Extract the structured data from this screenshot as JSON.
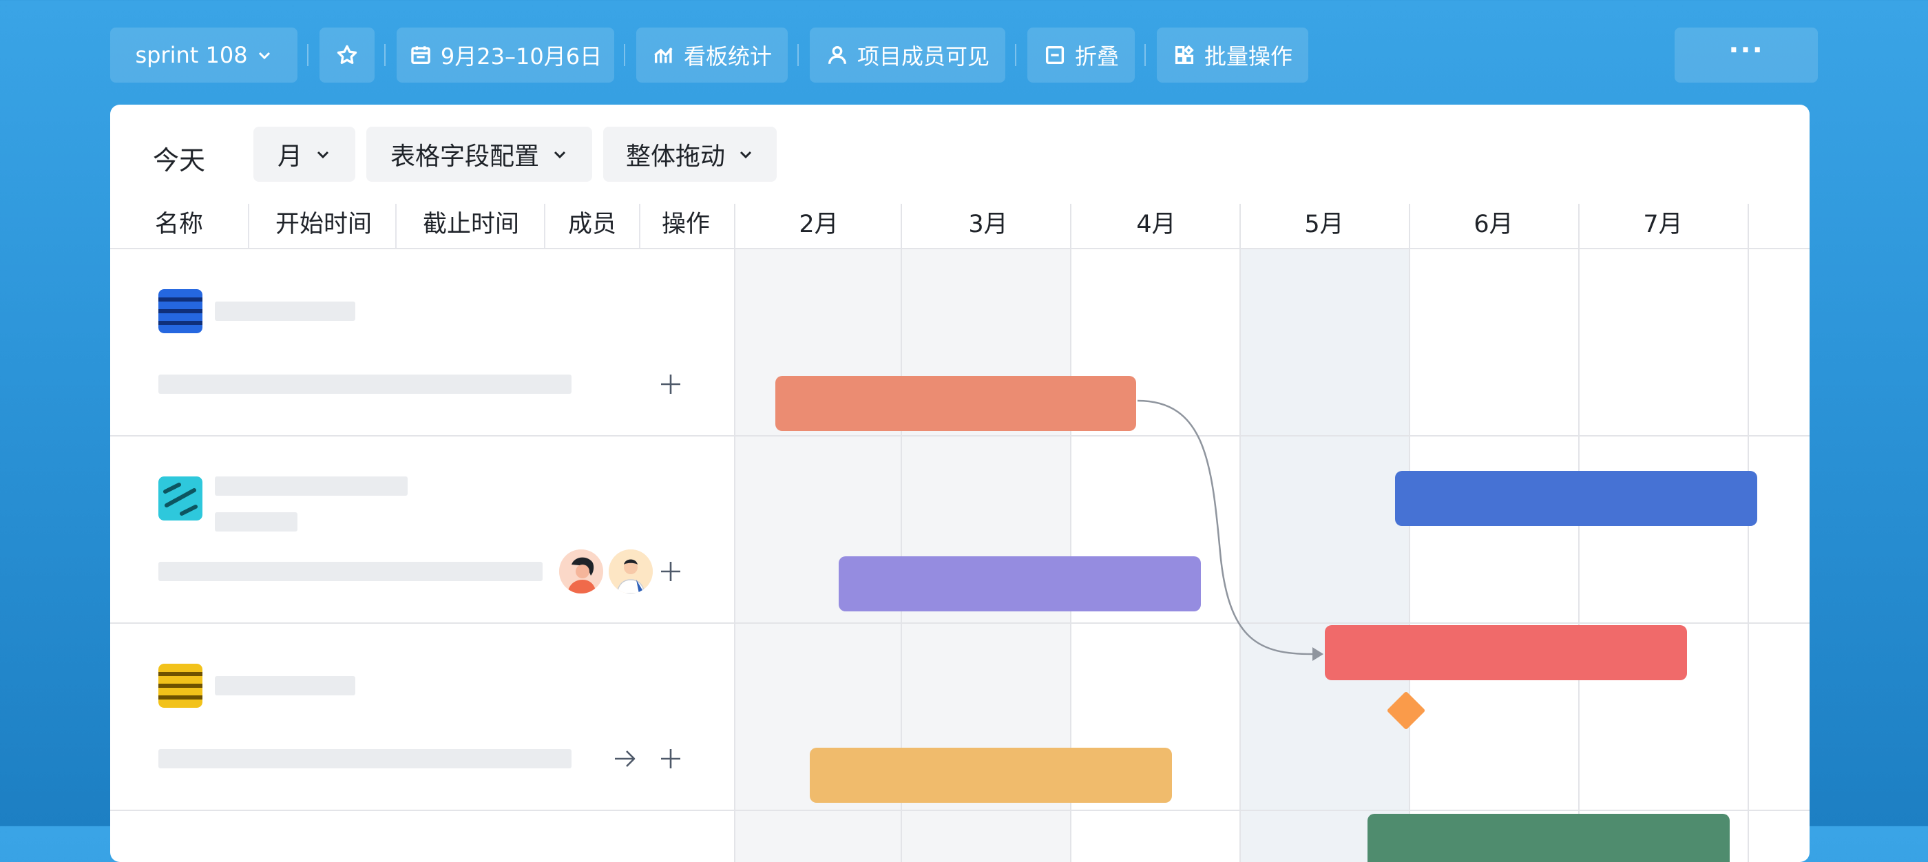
{
  "toolbar": {
    "sprint_label": "sprint 108",
    "date_range": "9月23–10月6日",
    "board_stats": "看板统计",
    "members_visible": "项目成员可见",
    "collapse": "折叠",
    "batch": "批量操作",
    "more": "···"
  },
  "view": {
    "today": "今天",
    "scale": "月",
    "field_config": "表格字段配置",
    "drag_mode": "整体拖动"
  },
  "table": {
    "columns": [
      "名称",
      "开始时间",
      "截止时间",
      "成员",
      "操作"
    ]
  },
  "timeline": {
    "months": [
      "2月",
      "3月",
      "4月",
      "5月",
      "6月",
      "7月"
    ]
  },
  "colors": {
    "bar_salmon": "#eb8c72",
    "bar_blue": "#4672d4",
    "bar_purple": "#958ce0",
    "bar_red": "#f06a6a",
    "bar_yellow": "#f0bb6c",
    "bar_green": "#4f8c6e",
    "milestone": "#fa9b4a"
  }
}
